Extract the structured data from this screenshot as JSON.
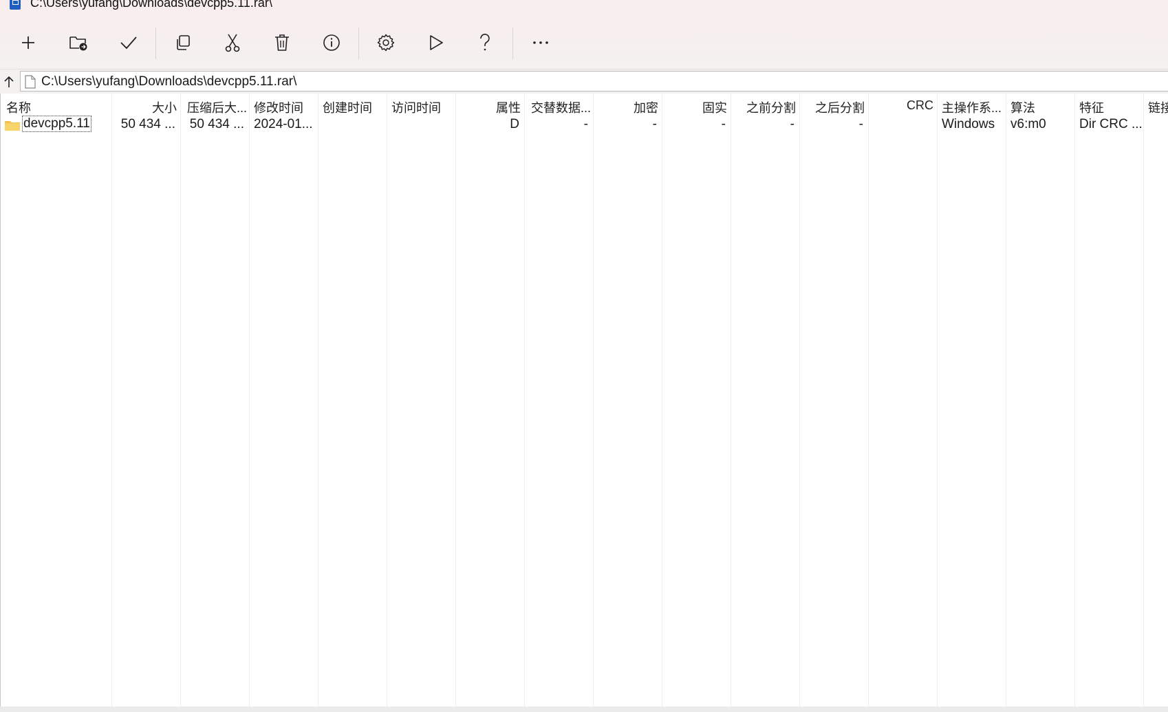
{
  "window": {
    "title": "C:\\Users\\yufang\\Downloads\\devcpp5.11.rar\\"
  },
  "toolbar": {
    "buttons": [
      {
        "icon": "plus-icon",
        "name": "add"
      },
      {
        "icon": "folder-extract-icon",
        "name": "extract"
      },
      {
        "icon": "checkmark-icon",
        "name": "test"
      },
      {
        "icon": "copy-icon",
        "name": "copy"
      },
      {
        "icon": "scissors-icon",
        "name": "move"
      },
      {
        "icon": "trash-icon",
        "name": "delete"
      },
      {
        "icon": "info-icon",
        "name": "info"
      },
      {
        "icon": "gear-icon",
        "name": "settings"
      },
      {
        "icon": "play-icon",
        "name": "benchmark"
      },
      {
        "icon": "question-icon",
        "name": "help"
      },
      {
        "icon": "more-icon",
        "name": "more"
      }
    ]
  },
  "address": {
    "path": "C:\\Users\\yufang\\Downloads\\devcpp5.11.rar\\"
  },
  "list": {
    "columns": [
      "名称",
      "大小",
      "压缩后大...",
      "修改时间",
      "创建时间",
      "访问时间",
      "属性",
      "交替数据...",
      "加密",
      "固实",
      "之前分割",
      "之后分割",
      "CRC",
      "主操作系...",
      "算法",
      "特征",
      "链接"
    ],
    "rows": [
      {
        "name": "devcpp5.11",
        "size": "50 434 ...",
        "packed": "50 434 ...",
        "modified": "2024-01...",
        "created": "",
        "accessed": "",
        "attributes": "D",
        "alt_streams": "-",
        "encrypted": "-",
        "solid": "-",
        "split_before": "-",
        "split_after": "-",
        "crc": "",
        "host_os": "Windows",
        "method": "v6:m0",
        "characteristics": "Dir CRC ...",
        "link": ""
      }
    ]
  }
}
